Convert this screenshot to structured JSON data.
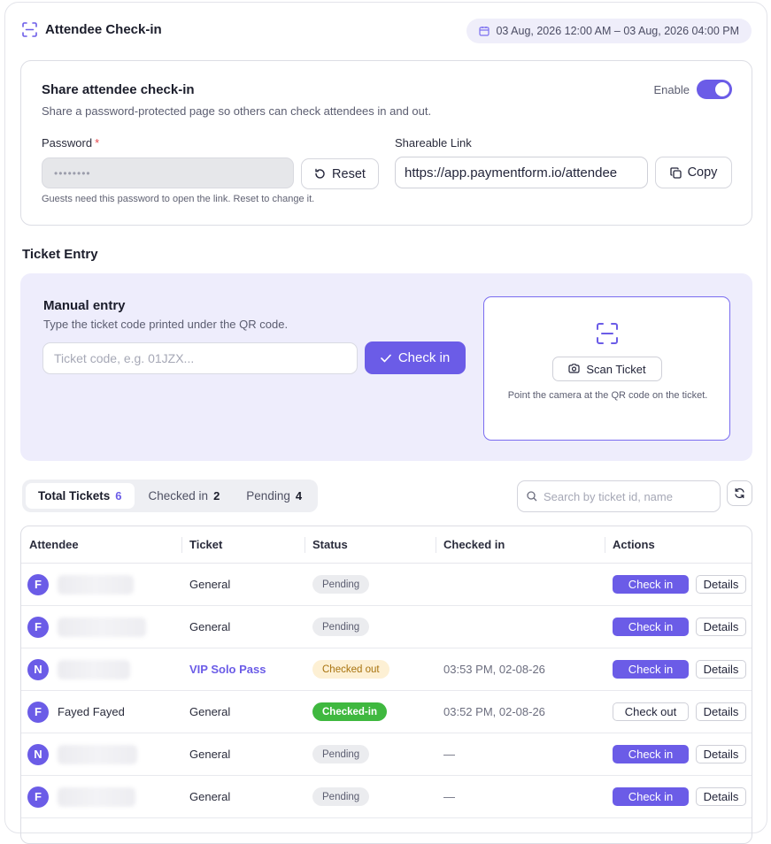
{
  "header": {
    "title": "Attendee Check-in",
    "date_range": "03 Aug, 2026 12:00 AM – 03 Aug, 2026 04:00 PM"
  },
  "share": {
    "title": "Share attendee check-in",
    "subtitle": "Share a password-protected page so others can check attendees in and out.",
    "enable_label": "Enable",
    "enabled": true,
    "password_label": "Password",
    "password_required_mark": "*",
    "password_value": "••••••••",
    "reset_label": "Reset",
    "link_label": "Shareable Link",
    "link_value": "https://app.paymentform.io/attendee",
    "copy_label": "Copy",
    "hint": "Guests need this password to open the link. Reset to change it."
  },
  "ticket_entry": {
    "section_title": "Ticket Entry",
    "manual_title": "Manual entry",
    "manual_subtitle": "Type the ticket code printed under the QR code.",
    "code_placeholder": "Ticket code, e.g. 01JZX...",
    "checkin_label": "Check in",
    "scan_label": "Scan Ticket",
    "scan_caption": "Point the camera at the QR code on the ticket."
  },
  "tabs": [
    {
      "label": "Total Tickets",
      "count": "6"
    },
    {
      "label": "Checked in",
      "count": "2"
    },
    {
      "label": "Pending",
      "count": "4"
    }
  ],
  "search": {
    "placeholder": "Search by ticket id, name"
  },
  "table": {
    "columns": [
      "Attendee",
      "Ticket",
      "Status",
      "Checked in",
      "Actions"
    ],
    "rows": [
      {
        "initial": "F",
        "name": "",
        "ticket": "General",
        "status": "Pending",
        "checked_in": "",
        "action": "Check in",
        "details": "Details"
      },
      {
        "initial": "F",
        "name": "",
        "ticket": "General",
        "status": "Pending",
        "checked_in": "",
        "action": "Check in",
        "details": "Details"
      },
      {
        "initial": "N",
        "name": "",
        "ticket": "VIP Solo Pass",
        "status": "Checked out",
        "checked_in": "03:53 PM, 02-08-26",
        "action": "Check in",
        "details": "Details"
      },
      {
        "initial": "F",
        "name": "Fayed Fayed",
        "ticket": "General",
        "status": "Checked-in",
        "checked_in": "03:52 PM, 02-08-26",
        "action": "Check out",
        "details": "Details"
      },
      {
        "initial": "N",
        "name": "",
        "ticket": "General",
        "status": "Pending",
        "checked_in": "—",
        "action": "Check in",
        "details": "Details"
      },
      {
        "initial": "F",
        "name": "",
        "ticket": "General",
        "status": "Pending",
        "checked_in": "—",
        "action": "Check in",
        "details": "Details"
      }
    ]
  },
  "colors": {
    "accent": "#6b5ce7",
    "success": "#3fb83f",
    "warning_bg": "#fdf0d4"
  }
}
